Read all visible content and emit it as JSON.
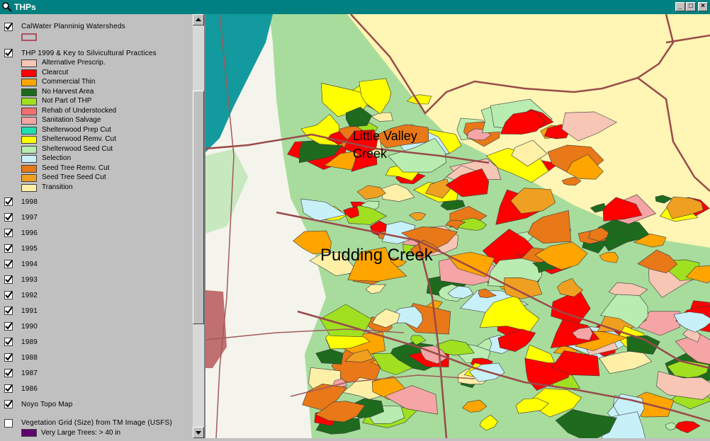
{
  "window": {
    "title": "THPs",
    "app_icon": "magnifier-icon",
    "controls": [
      "_",
      "□",
      "×"
    ]
  },
  "toc": {
    "watershed_layer": {
      "label": "CalWater Planninig Watersheds",
      "checked": true,
      "symbol_color": "#b05060"
    },
    "thp1999_layer": {
      "label": "THP 1999 & Key to Silvicultural Practices",
      "checked": true,
      "legend": [
        {
          "label": "Alternative Prescrip.",
          "color": "#f7c6b5"
        },
        {
          "label": "Clearcut",
          "color": "#ff0000"
        },
        {
          "label": "Commercial Thin",
          "color": "#ffa500"
        },
        {
          "label": "No Harvest Area",
          "color": "#1e6b1e"
        },
        {
          "label": "Not Part of THP",
          "color": "#a0e020"
        },
        {
          "label": "Rehab of Understocked",
          "color": "#f07070"
        },
        {
          "label": "Sanitation Salvage",
          "color": "#f5a5a5"
        },
        {
          "label": "Shelterwood Prep Cut",
          "color": "#20e0b0"
        },
        {
          "label": "Shelterwood Remv. Cut",
          "color": "#ffff00"
        },
        {
          "label": "Shelterwood Seed Cut",
          "color": "#b8ecb0"
        },
        {
          "label": "Selection",
          "color": "#c8f0f8"
        },
        {
          "label": "Seed Tree Remv. Cut",
          "color": "#e87818"
        },
        {
          "label": "Seed Tree Seed Cut",
          "color": "#f0a020"
        },
        {
          "label": "Transition",
          "color": "#fff0a8"
        }
      ]
    },
    "year_layers": [
      {
        "label": "1998",
        "checked": true
      },
      {
        "label": "1997",
        "checked": true
      },
      {
        "label": "1996",
        "checked": true
      },
      {
        "label": "1995",
        "checked": true
      },
      {
        "label": "1994",
        "checked": true
      },
      {
        "label": "1993",
        "checked": true
      },
      {
        "label": "1992",
        "checked": true
      },
      {
        "label": "1991",
        "checked": true
      },
      {
        "label": "1990",
        "checked": true
      },
      {
        "label": "1989",
        "checked": true
      },
      {
        "label": "1988",
        "checked": true
      },
      {
        "label": "1987",
        "checked": true
      },
      {
        "label": "1986",
        "checked": true
      }
    ],
    "topo_layer": {
      "label": "Noyo Topo Map",
      "checked": true
    },
    "vegetation_layer": {
      "label": "Vegetation Grid (Size) from TM Image (USFS)",
      "checked": false,
      "legend": [
        {
          "label": "Very Large Trees: > 40  in",
          "color": "#600070"
        }
      ]
    }
  },
  "map": {
    "labels": {
      "little_valley_1": "Little Valley",
      "little_valley_2": "Creek",
      "pudding_creek": "Pudding Creek"
    },
    "colors": {
      "ocean": "#129a9e",
      "topo_land": "#f4f4ec",
      "forest_green": "#a8dc9c",
      "beige": "#fff5b4",
      "watershed_line": "#9a4a4a",
      "road": "#a05a5a",
      "town": "#c07070"
    }
  }
}
